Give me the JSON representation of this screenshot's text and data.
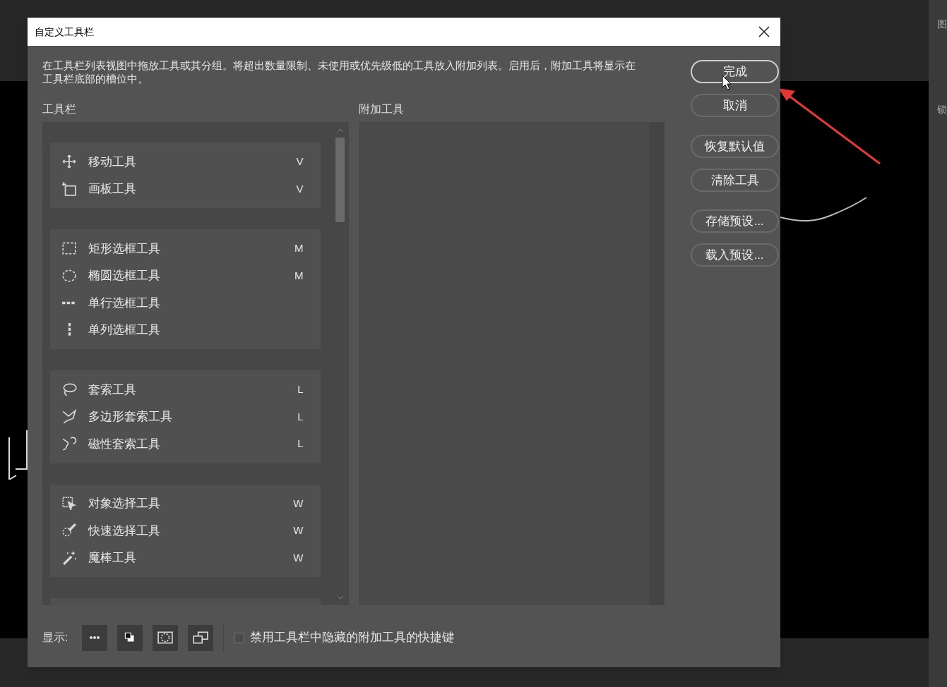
{
  "window": {
    "title": "自定义工具栏"
  },
  "description": "在工具栏列表视图中拖放工具或其分组。将超出数量限制、未使用或优先级低的工具放入附加列表。启用后，附加工具将显示在工具栏底部的槽位中。",
  "toolbar_list": {
    "label": "工具栏",
    "groups": [
      {
        "tools": [
          {
            "kind": "move",
            "name": "移动工具",
            "shortcut": "V"
          },
          {
            "kind": "artboard",
            "name": "画板工具",
            "shortcut": "V"
          }
        ]
      },
      {
        "tools": [
          {
            "kind": "rect",
            "name": "矩形选框工具",
            "shortcut": "M"
          },
          {
            "kind": "ellipse",
            "name": "椭圆选框工具",
            "shortcut": "M"
          },
          {
            "kind": "row",
            "name": "单行选框工具"
          },
          {
            "kind": "col",
            "name": "单列选框工具"
          }
        ]
      },
      {
        "tools": [
          {
            "kind": "lasso",
            "name": "套索工具",
            "shortcut": "L"
          },
          {
            "kind": "poly",
            "name": "多边形套索工具",
            "shortcut": "L"
          },
          {
            "kind": "magnet",
            "name": "磁性套索工具",
            "shortcut": "L"
          }
        ]
      },
      {
        "tools": [
          {
            "kind": "object",
            "name": "对象选择工具",
            "shortcut": "W"
          },
          {
            "kind": "quick",
            "name": "快速选择工具",
            "shortcut": "W"
          },
          {
            "kind": "wand",
            "name": "魔棒工具",
            "shortcut": "W"
          }
        ]
      }
    ]
  },
  "extra_tools": {
    "label": "附加工具"
  },
  "buttons": [
    {
      "label": "完成",
      "kind": "default"
    },
    {
      "label": "取消",
      "kind": "normal"
    },
    {
      "label": "恢复默认值",
      "kind": "normal"
    },
    {
      "label": "清除工具",
      "kind": "normal"
    },
    {
      "label": "存储预设...",
      "kind": "normal"
    },
    {
      "label": "载入预设...",
      "kind": "normal"
    }
  ],
  "footer": {
    "show_label": "显示:",
    "show_buttons": [
      {
        "kind": "dots"
      },
      {
        "kind": "swatch"
      },
      {
        "kind": "mask"
      },
      {
        "kind": "screen"
      }
    ],
    "checkbox": {
      "label": "禁用工具栏中隐藏的附加工具的快捷键",
      "checked": false
    }
  },
  "side_panel": {
    "labels": [
      "图",
      "锁"
    ]
  }
}
